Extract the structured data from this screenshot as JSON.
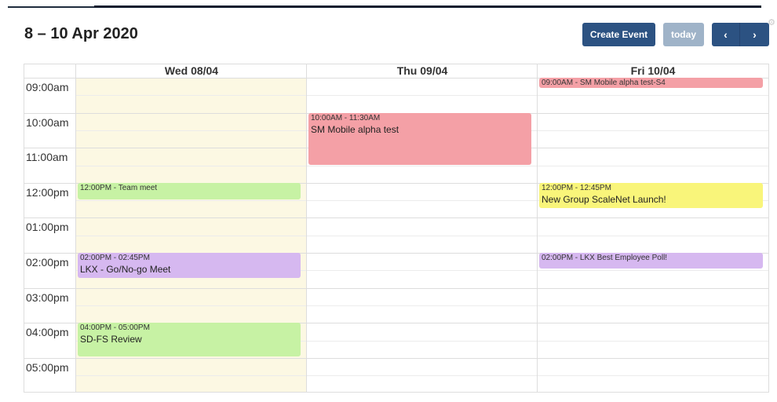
{
  "header": {
    "title": "8 – 10 Apr 2020",
    "create_event_label": "Create Event",
    "today_label": "today",
    "prev_label": "‹",
    "next_label": "›"
  },
  "columns": [
    "Wed 08/04",
    "Thu 09/04",
    "Fri 10/04"
  ],
  "times": [
    "09:00am",
    "10:00am",
    "11:00am",
    "12:00pm",
    "01:00pm",
    "02:00pm",
    "03:00pm",
    "04:00pm",
    "05:00pm"
  ],
  "events": [
    {
      "id": "e1",
      "time": "09:00AM - SM Mobile alpha test-S4",
      "name": ""
    },
    {
      "id": "e2",
      "time": "10:00AM - 11:30AM",
      "name": "SM Mobile alpha test"
    },
    {
      "id": "e3",
      "time": "12:00PM - Team meet",
      "name": ""
    },
    {
      "id": "e4",
      "time": "12:00PM - 12:45PM",
      "name": "New Group ScaleNet Launch!"
    },
    {
      "id": "e5",
      "time": "02:00PM - 02:45PM",
      "name": "LKX - Go/No-go Meet"
    },
    {
      "id": "e6",
      "time": "02:00PM - LKX Best Employee Poll!",
      "name": ""
    },
    {
      "id": "e7",
      "time": "04:00PM - 05:00PM",
      "name": "SD-FS Review"
    }
  ],
  "colors": {
    "primary_button": "#2c5282",
    "today_button": "#9fb3c8",
    "today_highlight": "#fcf8e3",
    "event_red": "#f4a0a6",
    "event_green": "#c7f2a4",
    "event_purple": "#d6b8f0",
    "event_yellow": "#f9f57a"
  },
  "icons": {
    "prev": "chevron-left-icon",
    "next": "chevron-right-icon",
    "corner": "gear-icon"
  }
}
